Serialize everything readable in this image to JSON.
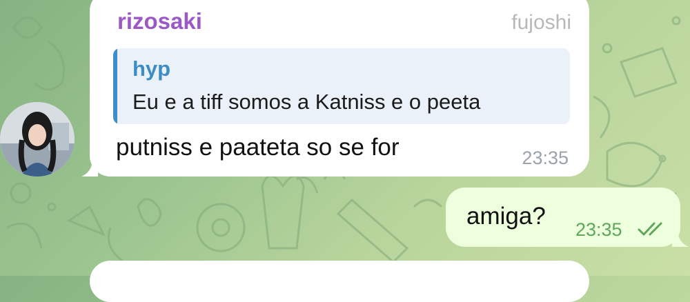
{
  "incoming": {
    "sender": "rizosaki",
    "badge": "fujoshi",
    "reply": {
      "author": "hyp",
      "text": "Eu e a tiff somos a Katniss e o peeta"
    },
    "text": "putniss e paateta so se for",
    "time": "23:35"
  },
  "outgoing": {
    "text": "amiga?",
    "time": "23:35",
    "status_icon": "double-check-icon"
  },
  "colors": {
    "sender": "#9b59c6",
    "reply_accent": "#3f8ec9",
    "outgoing_bubble": "#eeffde",
    "outgoing_meta": "#5da65a"
  }
}
